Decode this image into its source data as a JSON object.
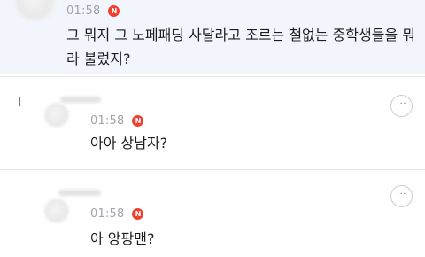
{
  "comments": [
    {
      "time": "01:58",
      "badge": "N",
      "text_line1": "그 뭐지 그 노페패딩 사달라고 조르는 철없는 중학생들을 뭐",
      "text_line2": "라 불렀지?"
    },
    {
      "time": "01:58",
      "badge": "N",
      "text": "아아 상남자?",
      "more": "···"
    },
    {
      "time": "01:58",
      "badge": "N",
      "text": "아 앙팡맨?",
      "more": "···"
    }
  ]
}
